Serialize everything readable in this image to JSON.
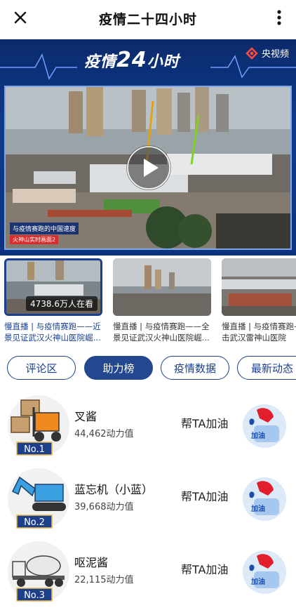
{
  "header": {
    "title": "疫情二十四小时",
    "close_icon": "close-icon",
    "more_icon": "more-vertical-icon"
  },
  "banner": {
    "brand_prefix": "疫情",
    "brand_number": "24",
    "brand_suffix": "小时",
    "channel": "央视频",
    "tag_line": "与疫情赛跑的中国速度",
    "tag_sub": "火神山实时画面2",
    "colors": {
      "bg": "#0e3b8c",
      "accent": "#d9261c"
    }
  },
  "videos": [
    {
      "caption": "慢直播 | 与疫情赛跑——近景见证武汉火神山医院崛…",
      "viewers": "4738.6万人在看",
      "active": true
    },
    {
      "caption": "慢直播 | 与疫情赛跑——全景见证武汉火神山医院崛…",
      "viewers": "",
      "active": false
    },
    {
      "caption": "慢直播 | 与疫情赛跑——直击武汉雷神山医院",
      "viewers": "",
      "active": false
    }
  ],
  "tabs": [
    {
      "label": "评论区",
      "active": false
    },
    {
      "label": "助力榜",
      "active": true
    },
    {
      "label": "疫情数据",
      "active": false
    },
    {
      "label": "最新动态",
      "active": false
    }
  ],
  "ranking": [
    {
      "rank": "No.1",
      "name": "叉酱",
      "score": "44,462动力值",
      "action": "帮TA加油",
      "button": "加油",
      "icon": "forklift-icon"
    },
    {
      "rank": "No.2",
      "name": "蓝忘机（小蓝）",
      "score": "39,668动力值",
      "action": "帮TA加油",
      "button": "加油",
      "icon": "excavator-icon"
    },
    {
      "rank": "No.3",
      "name": "呕泥酱",
      "score": "22,115动力值",
      "action": "帮TA加油",
      "button": "加油",
      "icon": "cement-mixer-icon"
    }
  ]
}
